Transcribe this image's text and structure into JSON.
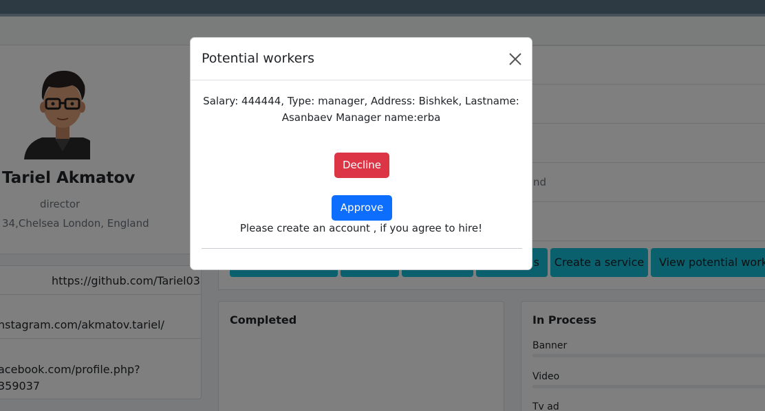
{
  "profile": {
    "name": "Tariel Akmatov",
    "role": "director",
    "address": "34,Chelsea London, England",
    "avatar_icon": "cartoon-man-with-glasses"
  },
  "links": [
    "https://github.com/Tariel03",
    "nstagram.com/akmatov.tariel/",
    "acebook.com/profile.php?",
    "359037"
  ],
  "info_fragment": "nd",
  "actions": {
    "create_service": "Create a service",
    "view_potential_workers": "View potential worke",
    "partial_label": "s"
  },
  "panels": {
    "completed_title": "Completed",
    "in_process_title": "In Process",
    "in_process_items": [
      {
        "label": "Banner",
        "progress": 0
      },
      {
        "label": "Video",
        "progress": 0
      },
      {
        "label": "Tv ad",
        "progress": 0
      }
    ]
  },
  "modal": {
    "title": "Potential workers",
    "details": "Salary: 444444, Type: manager, Address: Bishkek, Lastname: Asanbaev Manager name:erba",
    "decline_label": "Decline",
    "approve_label": "Approve",
    "note": "Please create an account , if you agree to hire!"
  },
  "colors": {
    "decline": "#dc3545",
    "approve": "#0d6efd",
    "action_button": "#17c0dd"
  }
}
